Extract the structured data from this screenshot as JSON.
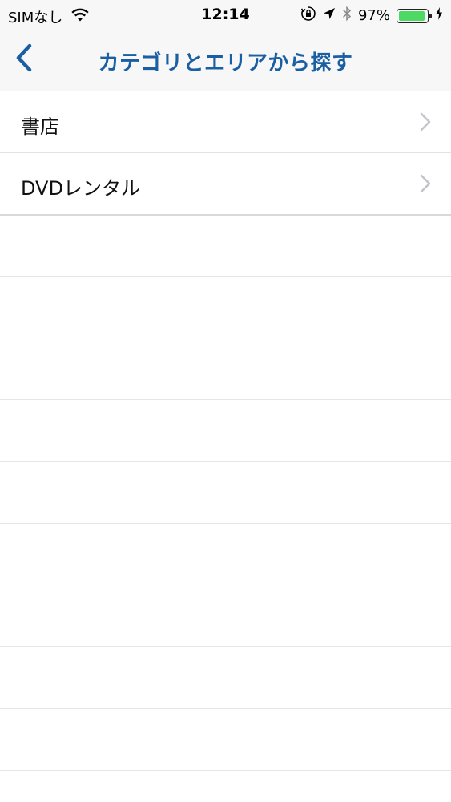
{
  "status_bar": {
    "carrier": "SIMなし",
    "time": "12:14",
    "battery_percent": "97%",
    "battery_level": 0.97,
    "battery_color": "#4cd964"
  },
  "nav": {
    "title": "カテゴリとエリアから探す",
    "title_color": "#1b5fa3",
    "back_icon": "chevron-left-icon"
  },
  "list": {
    "items": [
      {
        "label": "書店"
      },
      {
        "label": "DVDレンタル"
      }
    ]
  }
}
